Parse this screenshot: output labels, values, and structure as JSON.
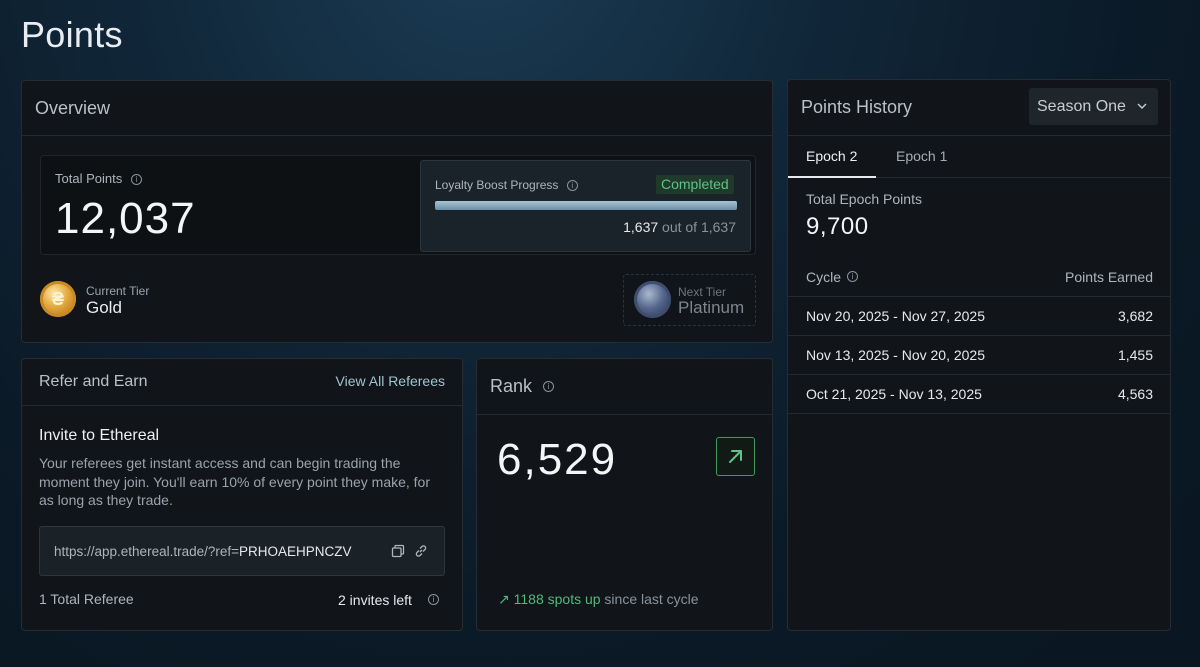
{
  "page": {
    "title": "Points"
  },
  "overview": {
    "header": "Overview",
    "total_points_label": "Total Points",
    "total_points_value": "12,037",
    "loyalty": {
      "label": "Loyalty Boost Progress",
      "status": "Completed",
      "current": "1,637",
      "out_of_text": "out of 1,637",
      "progress_fraction": 1.0
    },
    "current_tier": {
      "label": "Current Tier",
      "value": "Gold"
    },
    "next_tier": {
      "label": "Next Tier",
      "value": "Platinum"
    }
  },
  "refer": {
    "header": "Refer and Earn",
    "view_all": "View All Referees",
    "invite_title": "Invite to Ethereal",
    "invite_desc": "Your referees get instant access and can begin trading the moment they join. You'll earn 10% of every point they make, for as long as they trade.",
    "ref_url_prefix": "https://app.ethereal.trade/?ref=",
    "ref_code": "PRHOAEHPNCZV",
    "total_referee": "1 Total Referee",
    "invites_left": "2 invites left"
  },
  "rank": {
    "header": "Rank",
    "value": "6,529",
    "change_up": "1188 spots up",
    "change_suffix": " since last cycle"
  },
  "history": {
    "header": "Points History",
    "season": "Season One",
    "tabs": [
      "Epoch 2",
      "Epoch 1"
    ],
    "total_epoch_label": "Total Epoch Points",
    "total_epoch_value": "9,700",
    "col_cycle": "Cycle",
    "col_points": "Points Earned",
    "rows": [
      {
        "cycle": "Nov 20, 2025 - Nov 27, 2025",
        "points": "3,682"
      },
      {
        "cycle": "Nov 13, 2025 - Nov 20, 2025",
        "points": "1,455"
      },
      {
        "cycle": "Oct 21, 2025 - Nov 13, 2025",
        "points": "4,563"
      }
    ]
  },
  "colors": {
    "accent_green": "#52b97a",
    "link": "#9ec4cf",
    "bg": "#0b1a27"
  },
  "icons": [
    "info-icon",
    "copy-icon",
    "link-icon",
    "arrow-up-right-icon",
    "chevron-down-icon",
    "gold-tier-icon",
    "platinum-tier-icon"
  ]
}
